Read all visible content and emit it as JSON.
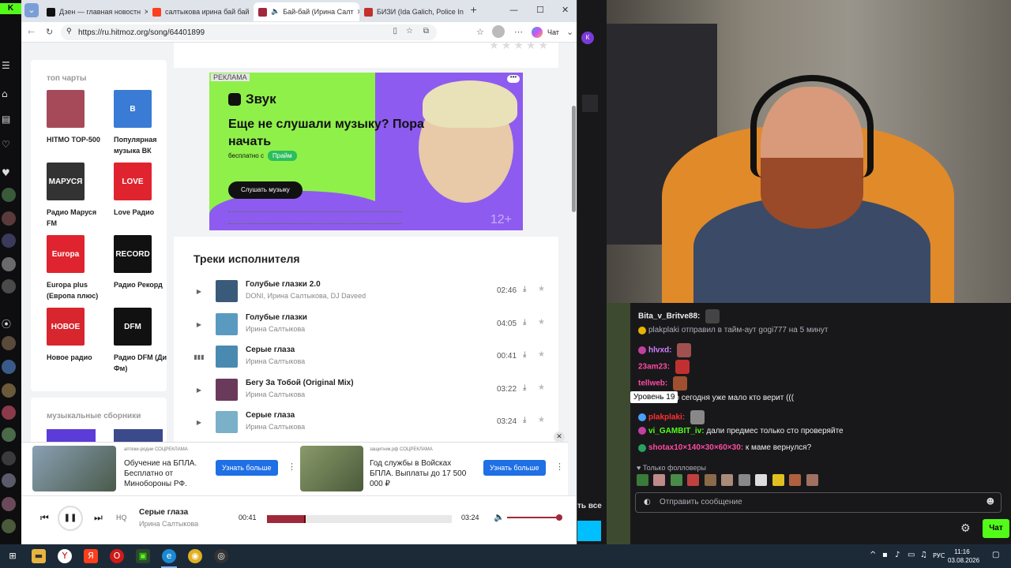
{
  "browser": {
    "tabs": [
      {
        "label": "Дзен — главная новостн",
        "color": "#1a1a1a"
      },
      {
        "label": "салтыкова ирина бай бай",
        "color": "#fc3f1d"
      },
      {
        "label": "Бай-бай (Ирина Салт",
        "color": "#a0283b",
        "active": true
      },
      {
        "label": "БИЗИ (Ida Galich, Police In",
        "color": "#c4302b"
      }
    ],
    "url": "https://ru.hitmoz.org/song/64401899",
    "chat_label": "Чат"
  },
  "sidebar": {
    "charts_title": "топ чарты",
    "charts": [
      {
        "label": "HITMO TOP-500",
        "thumb_color": "#a64a5a",
        "thumb_text": ""
      },
      {
        "label": "Популярная музыка ВК",
        "thumb_color": "#3a7bd5",
        "thumb_text": "B"
      },
      {
        "label": "Радио Маруся FM",
        "thumb_color": "#333333",
        "thumb_text": "МАРУСЯ"
      },
      {
        "label": "Love Радио",
        "thumb_color": "#e0242f",
        "thumb_text": "LOVE"
      },
      {
        "label": "Europa plus (Европа плюс)",
        "thumb_color": "#e0242f",
        "thumb_text": "Europa"
      },
      {
        "label": "Радио Рекорд",
        "thumb_color": "#111111",
        "thumb_text": "RECORD"
      },
      {
        "label": "Новое радио",
        "thumb_color": "#d7262e",
        "thumb_text": "НОВОЕ"
      },
      {
        "label": "Радио DFM (Ди Фм)",
        "thumb_color": "#111111",
        "thumb_text": "DFM"
      }
    ],
    "collections_title": "музыкальные сборники"
  },
  "ad": {
    "reklama": "РЕКЛАМА",
    "brand": "Звук",
    "headline": "Еще не слушали музыку? Пора начать",
    "sub": "бесплатно с",
    "prime": "Прайм",
    "cta": "Слушать музыку",
    "age": "12+",
    "more": "•••"
  },
  "tracks": {
    "title": "Треки исполнителя",
    "items": [
      {
        "title": "Голубые глазки 2.0",
        "artist": "DONI, Ирина Салтыкова, DJ Daveed",
        "duration": "02:46",
        "cover": "#3a5a7a",
        "playing": false
      },
      {
        "title": "Голубые глазки",
        "artist": "Ирина Салтыкова",
        "duration": "04:05",
        "cover": "#5a9ac0",
        "playing": false
      },
      {
        "title": "Серые глаза",
        "artist": "Ирина Салтыкова",
        "duration": "00:41",
        "cover": "#4a8ab0",
        "playing": true
      },
      {
        "title": "Бегу За Тобой (Original Mix)",
        "artist": "Ирина Салтыкова",
        "duration": "03:22",
        "cover": "#6a3a5a",
        "playing": false
      },
      {
        "title": "Серые глаза",
        "artist": "Ирина Салтыкова",
        "duration": "03:24",
        "cover": "#7ab0c8",
        "playing": false
      }
    ]
  },
  "bottom_ads": [
    {
      "source": "аптеки-родни  СОЦРЕКЛАМА",
      "text": "Обучение на БПЛА. Бесплатно от Минобороны РФ.",
      "button": "Узнать больше",
      "img": "#5a6a7a"
    },
    {
      "source": "защитник.рф  СОЦРЕКЛАМА",
      "text": "Год службы в Войсках БПЛА. Выплаты до 17 500 000 ₽",
      "button": "Узнать больше",
      "img": "#6a7a5a"
    }
  ],
  "player": {
    "hq": "HQ",
    "title": "Серые глаза",
    "artist": "Ирина Салтыкова",
    "current": "00:41",
    "total": "03:24",
    "progress": 0.2,
    "volume": 1.0
  },
  "stream": {
    "see_all": "ть все"
  },
  "chat": {
    "messages": [
      {
        "user": "Bita_v_Britve88:",
        "text": "",
        "color": "#efeff1",
        "badge": "",
        "emote": "#444"
      },
      {
        "user": "",
        "text": "plakplaki отправил в тайм-аут gogi777 на 5 минут",
        "color": "#adadb8",
        "badge": "#e6b400",
        "emote": ""
      },
      {
        "user": "hlvxd:",
        "text": "",
        "color": "#d080ff",
        "badge": "#c040a0",
        "emote": "#a05050"
      },
      {
        "user": "23am23:",
        "text": "",
        "color": "#ff4aa0",
        "badge": "",
        "emote": "#c03030"
      },
      {
        "user": "tellweb:",
        "text": "",
        "color": "#ff4aa0",
        "badge": "",
        "emote": "#a05030"
      },
      {
        "user": "",
        "text": "ечально но сегодня уже мало кто верит (((",
        "color": "#efeff1",
        "badge": "",
        "emote": ""
      },
      {
        "user": "plakplaki:",
        "text": "",
        "color": "#ff3030",
        "badge": "#4aa0ff",
        "emote": "#888"
      },
      {
        "user": "vi_GAMBIT_iv:",
        "text": "дали предмес только сто проверяйте",
        "color": "#53fc18",
        "badge": "#c040a0",
        "emote": ""
      },
      {
        "user": "shotax10×140×30×60×30:",
        "text": "к маме вернулся?",
        "color": "#ff4aa0",
        "badge": "#2aa060",
        "emote": ""
      }
    ],
    "tooltip": "Уровень 19",
    "followers": "Только фолловеры",
    "input_placeholder": "Отправить сообщение",
    "send": "Чат"
  },
  "taskbar": {
    "lang": "РУС",
    "time": "11:16",
    "date": "03.08.2026"
  }
}
